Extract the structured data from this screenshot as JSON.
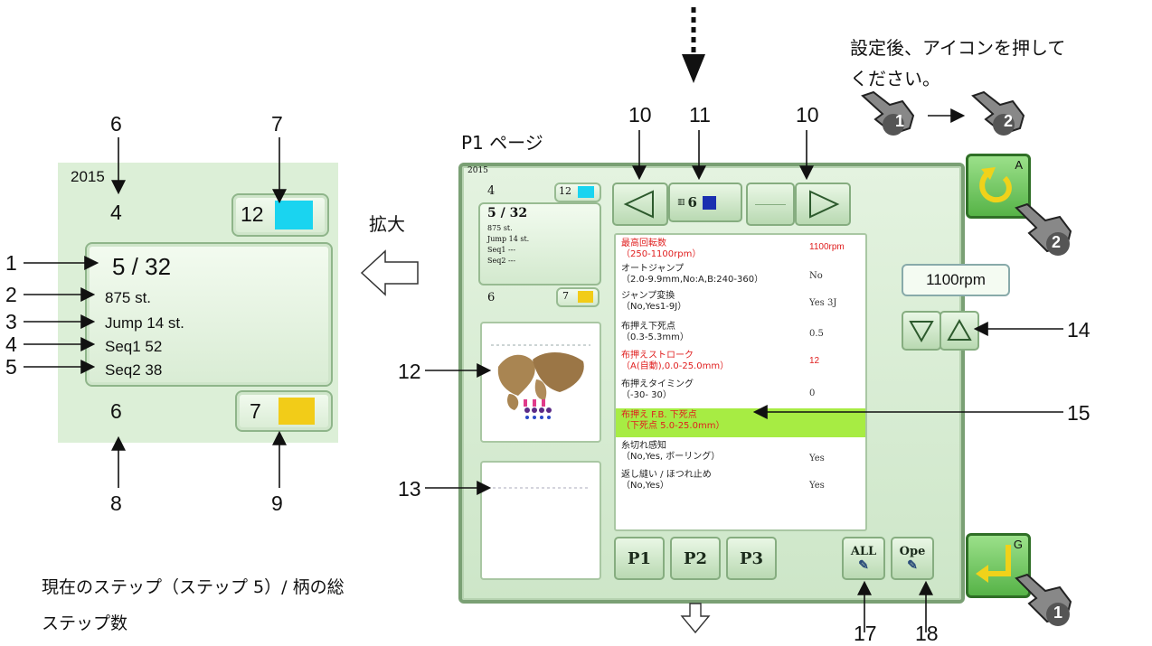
{
  "top_note": "設定後、アイコンを押して\nください。",
  "page_label": "P1 ページ",
  "expand_label": "拡大",
  "bottom_note": "現在のステップ（ステップ 5）/ 柄の総\nステップ数",
  "callouts": {
    "c1": "1",
    "c2": "2",
    "c3": "3",
    "c4": "4",
    "c5": "5",
    "c6": "6",
    "c7": "7",
    "c8": "8",
    "c9": "9",
    "c10a": "10",
    "c10b": "10",
    "c11": "11",
    "c12": "12",
    "c13": "13",
    "c14": "14",
    "c15": "15",
    "c17a": "17",
    "c17b": "18"
  },
  "enlarged": {
    "year": "2015",
    "top_left": "4",
    "top_right": "12",
    "step": "5 / 32",
    "stitches": "875 st.",
    "jump": "Jump 14 st.",
    "seq1": "Seq1 52",
    "seq2": "Seq2 38",
    "bottom_left": "6",
    "bottom_right": "7",
    "top_color": "#1ad4f0",
    "bottom_color": "#f2cc18"
  },
  "screen": {
    "year": "2015",
    "small_top_left": "4",
    "small_top_right": "12",
    "small_step": "5 / 32",
    "small_st": "875 st.",
    "small_jump": "Jump 14 st.",
    "small_seq1": "Seq1 ---",
    "small_seq2": "Seq2 ---",
    "small_bottom_left": "6",
    "small_bottom_right": "7",
    "needle_label": "6",
    "needle_color": "#1a2fb0",
    "rpm_display": "1100rpm",
    "tabs": [
      "P1",
      "P2",
      "P3"
    ],
    "all_label": "ALL",
    "ope_label": "Ope",
    "return_a_letter": "A",
    "return_g_letter": "G",
    "hand1": "1",
    "hand2": "2",
    "params": [
      {
        "name": "最高回転数",
        "range": "（250-1100rpm）",
        "value": "1100rpm"
      },
      {
        "name": "オートジャンプ",
        "range": "（2.0-9.9mm,No:A,B:240-360）",
        "value": "No"
      },
      {
        "name": "ジャンプ変換",
        "range": "（No,Yes1-9J）",
        "value": "Yes 3J"
      },
      {
        "name": "布押え下死点",
        "range": "（0.3-5.3mm）",
        "value": "0.5"
      },
      {
        "name": "布押えストローク",
        "range": "（A(自動),0.0-25.0mm）",
        "value": "12"
      },
      {
        "name": "布押えタイミング",
        "range": "（-30- 30）",
        "value": "0"
      },
      {
        "name": "布押え F.B. 下死点",
        "range": "（下死点 5.0-25.0mm）",
        "value": ""
      },
      {
        "name": "糸切れ感知",
        "range": "（No,Yes, ボーリング）",
        "value": "Yes"
      },
      {
        "name": "返し縫い / ほつれ止め",
        "range": "（No,Yes）",
        "value": "Yes"
      }
    ]
  }
}
